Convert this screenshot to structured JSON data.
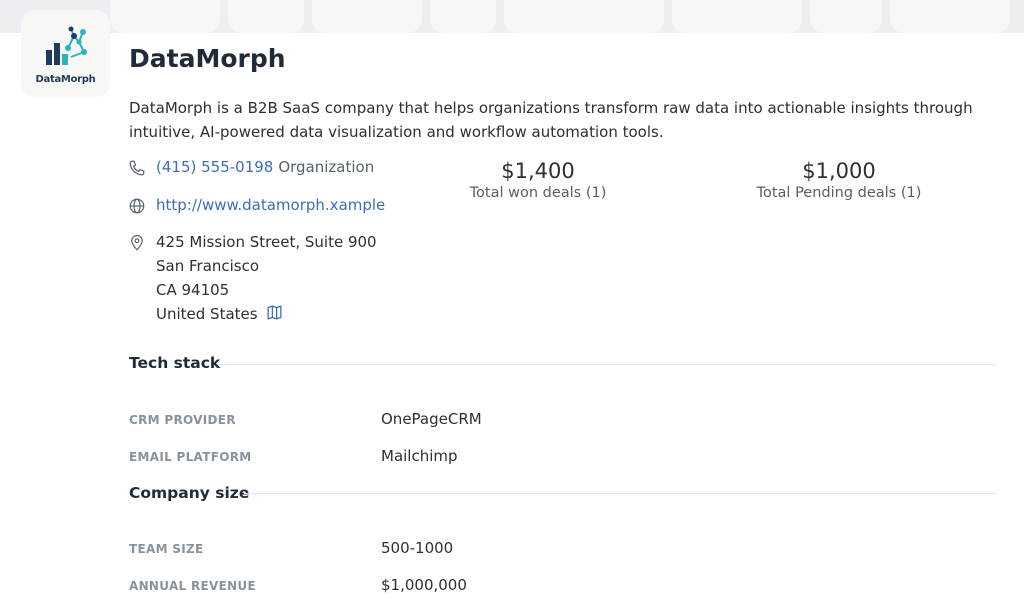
{
  "company": {
    "logo_text": "DataMorph",
    "name": "DataMorph",
    "description": "DataMorph is a B2B SaaS company that helps organizations transform raw data into actionable insights through intuitive, AI-powered data visualization and workflow automation tools."
  },
  "contact": {
    "phone": "(415) 555-0198",
    "phone_type": "Organization",
    "website": "http://www.datamorph.xample",
    "address": {
      "street": "425 Mission Street, Suite 900",
      "city": "San Francisco",
      "state_zip": "CA 94105",
      "country": "United States"
    }
  },
  "stats": [
    {
      "value": "$1,400",
      "label": "Total won deals (1)"
    },
    {
      "value": "$1,000",
      "label": "Total Pending deals (1)"
    }
  ],
  "sections": {
    "tech_stack": {
      "title": "Tech stack",
      "rows": [
        {
          "key": "CRM PROVIDER",
          "value": "OnePageCRM"
        },
        {
          "key": "EMAIL PLATFORM",
          "value": "Mailchimp"
        }
      ]
    },
    "company_size": {
      "title": "Company size",
      "rows": [
        {
          "key": "TEAM SIZE",
          "value": "500-1000"
        },
        {
          "key": "ANNUAL REVENUE",
          "value": "$1,000,000"
        }
      ]
    }
  },
  "icons": {
    "phone": "phone-icon",
    "web": "globe-icon",
    "location": "location-pin-icon",
    "map": "map-icon"
  },
  "colors": {
    "link": "#3d6db5",
    "logo_navy": "#1f3b5c",
    "logo_teal": "#2bb3c0"
  }
}
